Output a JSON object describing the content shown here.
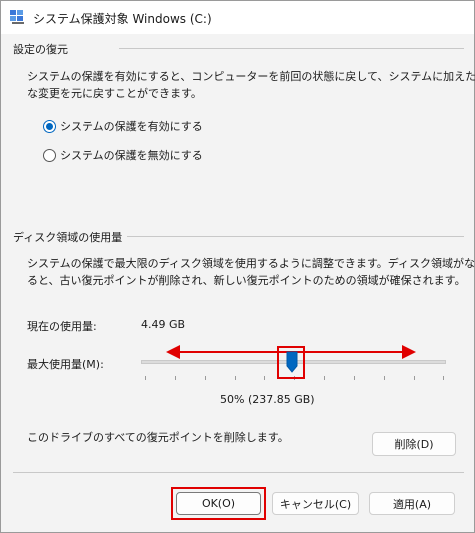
{
  "window": {
    "title": "システム保護対象 Windows (C:)"
  },
  "restore": {
    "group_title": "設定の復元",
    "description_line1": "システムの保護を有効にすると、コンピューターを前回の状態に戻して、システムに加えた不要",
    "description_line2": "な変更を元に戻すことができます。",
    "option_enable": "システムの保護を有効にする",
    "option_disable": "システムの保護を無効にする",
    "selected": "enable"
  },
  "disk": {
    "group_title": "ディスク領域の使用量",
    "description_line1": "システムの保護で最大限のディスク領域を使用するように調整できます。ディスク領域がなくな",
    "description_line2": "ると、古い復元ポイントが削除され、新しい復元ポイントのための領域が確保されます。",
    "current_label": "現在の使用量:",
    "current_value": "4.49 GB",
    "max_label": "最大使用量(M):",
    "slider_percent": 50,
    "slider_readout": "50% (237.85 GB)",
    "delete_text": "このドライブのすべての復元ポイントを削除します。",
    "delete_button": "削除(D)"
  },
  "footer": {
    "ok": "OK(O)",
    "cancel": "キャンセル(C)",
    "apply": "適用(A)"
  },
  "colors": {
    "accent": "#0067c0",
    "highlight": "#e00000"
  }
}
